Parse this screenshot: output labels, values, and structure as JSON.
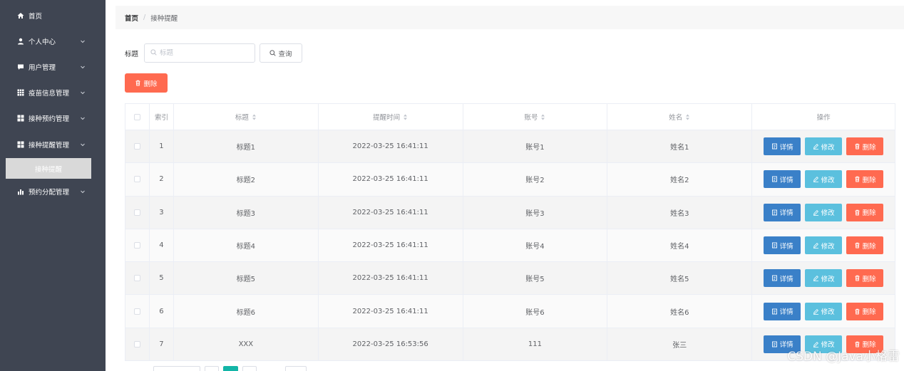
{
  "sidebar": {
    "items": [
      {
        "label": "首页",
        "icon": "home-icon"
      },
      {
        "label": "个人中心",
        "icon": "user-icon"
      },
      {
        "label": "用户管理",
        "icon": "chat-icon"
      },
      {
        "label": "疫苗信息管理",
        "icon": "grid-icon"
      },
      {
        "label": "接种预约管理",
        "icon": "grid-icon"
      },
      {
        "label": "接种提醒管理",
        "icon": "grid-icon"
      },
      {
        "label": "预约分配管理",
        "icon": "bar-chart-icon"
      }
    ],
    "active_sub": "接种提醒"
  },
  "breadcrumb": {
    "home": "首页",
    "separator": "/",
    "current": "接种提醒"
  },
  "search": {
    "label": "标题",
    "placeholder": "标题",
    "query_label": "查询"
  },
  "toolbar": {
    "delete_label": "删除"
  },
  "table": {
    "headers": {
      "index": "索引",
      "title": "标题",
      "time": "提醒时间",
      "account": "账号",
      "name": "姓名",
      "ops": "操作"
    },
    "rows": [
      {
        "index": "1",
        "title": "标题1",
        "time": "2022-03-25 16:41:11",
        "account": "账号1",
        "name": "姓名1"
      },
      {
        "index": "2",
        "title": "标题2",
        "time": "2022-03-25 16:41:11",
        "account": "账号2",
        "name": "姓名2"
      },
      {
        "index": "3",
        "title": "标题3",
        "time": "2022-03-25 16:41:11",
        "account": "账号3",
        "name": "姓名3"
      },
      {
        "index": "4",
        "title": "标题4",
        "time": "2022-03-25 16:41:11",
        "account": "账号4",
        "name": "姓名4"
      },
      {
        "index": "5",
        "title": "标题5",
        "time": "2022-03-25 16:41:11",
        "account": "账号5",
        "name": "姓名5"
      },
      {
        "index": "6",
        "title": "标题6",
        "time": "2022-03-25 16:41:11",
        "account": "账号6",
        "name": "姓名6"
      },
      {
        "index": "7",
        "title": "XXX",
        "time": "2022-03-25 16:53:56",
        "account": "111",
        "name": "张三"
      }
    ],
    "actions": {
      "detail": "详情",
      "edit": "修改",
      "delete": "删除"
    }
  },
  "watermark": "CSDN @Java小格雷",
  "colors": {
    "sidebar": "#3f4552",
    "danger": "#ff6a50",
    "primary": "#3a80c8",
    "info": "#5bc0de",
    "pager_active": "#13b5a7"
  }
}
